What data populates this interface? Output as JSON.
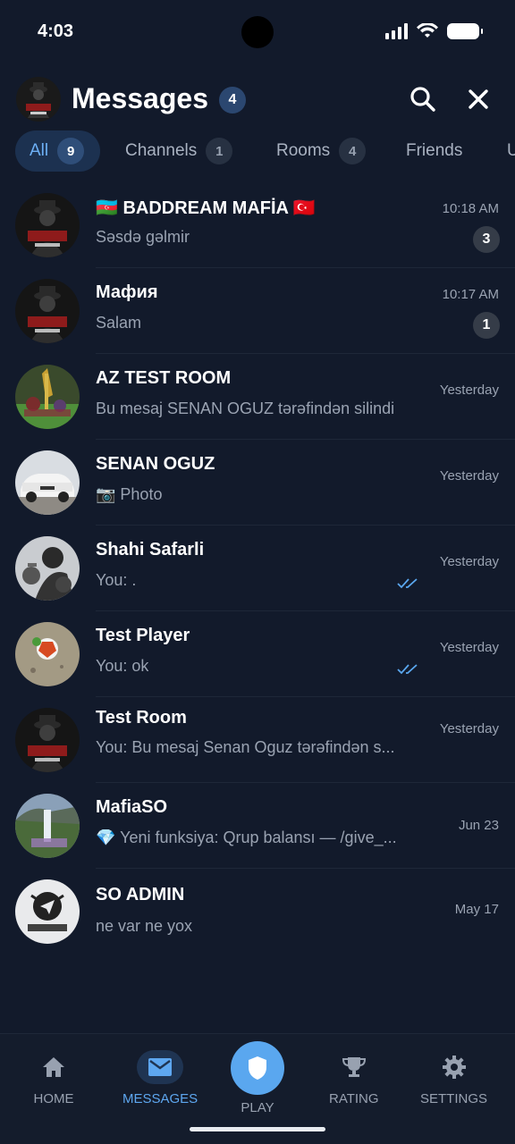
{
  "status": {
    "time": "4:03"
  },
  "header": {
    "title": "Messages",
    "badge": "4"
  },
  "tabs": [
    {
      "label": "All",
      "count": "9",
      "active": true
    },
    {
      "label": "Channels",
      "count": "1"
    },
    {
      "label": "Rooms",
      "count": "4"
    },
    {
      "label": "Friends",
      "count": ""
    },
    {
      "label": "U",
      "count": ""
    }
  ],
  "chats": [
    {
      "name": "🇦🇿 BADDREAM MAFİA 🇹🇷",
      "preview": "Səsdə gəlmir",
      "time": "10:18 AM",
      "unread": "3"
    },
    {
      "name": "Мафия",
      "preview": "Salam",
      "time": "10:17 AM",
      "unread": "1"
    },
    {
      "name": "AZ TEST ROOM",
      "preview": "Bu mesaj SENAN OGUZ tərəfindən silindi",
      "time": "Yesterday"
    },
    {
      "name": "SENAN OGUZ",
      "preview": "📷 Photo",
      "time": "Yesterday"
    },
    {
      "name": "Shahi Safarli",
      "preview": "You: .",
      "time": "Yesterday",
      "read": true
    },
    {
      "name": "Test Player",
      "preview": "You: ok",
      "time": "Yesterday",
      "read": true
    },
    {
      "name": "Test Room",
      "preview": "You: Bu mesaj Senan Oguz tərəfindən s...",
      "time": "Yesterday"
    },
    {
      "name": "MafiaSO",
      "preview": "💎 Yeni funksiya: Qrup balansı — /give_...",
      "time": "Jun 23"
    },
    {
      "name": "SO ADMIN",
      "preview": "ne var ne yox",
      "time": "May 17"
    }
  ],
  "nav": {
    "home": "HOME",
    "messages": "MESSAGES",
    "play": "PLAY",
    "rating": "RATING",
    "settings": "SETTINGS"
  },
  "colors": {
    "background": "#121a2b",
    "accent": "#5aa7ef",
    "active_tab_bg": "#1c3150"
  },
  "icons": {
    "search": "search-icon",
    "close": "close-icon",
    "home": "home-icon",
    "messages": "envelope-icon",
    "play": "shield-icon",
    "rating": "trophy-icon",
    "settings": "gear-icon",
    "read": "double-check-icon"
  }
}
